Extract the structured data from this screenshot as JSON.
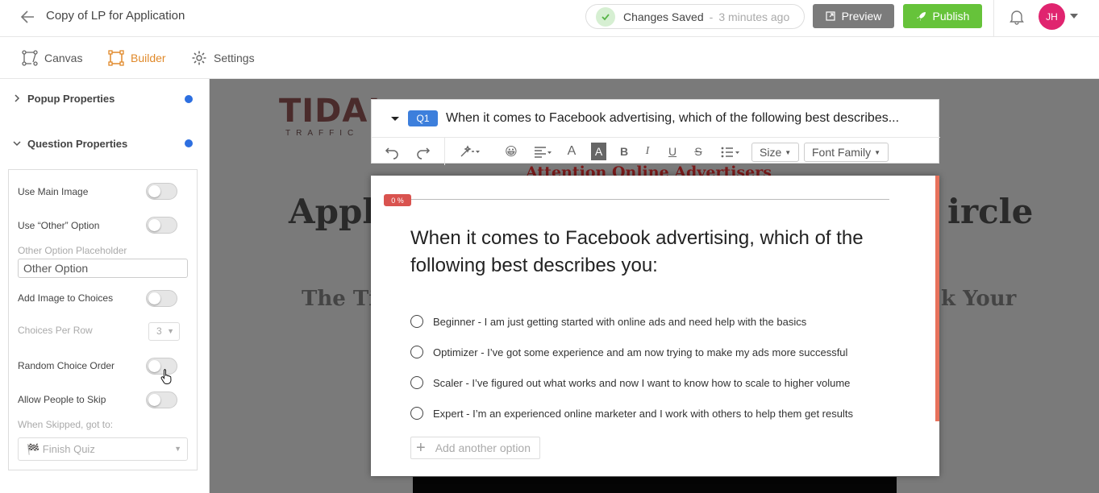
{
  "header": {
    "title": "Copy of LP for Application",
    "status_main": "Changes Saved",
    "status_sep": "-",
    "status_ago": "3 minutes ago",
    "preview_label": "Preview",
    "publish_label": "Publish",
    "avatar_initials": "JH"
  },
  "tabs": [
    {
      "label": "Canvas",
      "icon": "canvas-icon",
      "active": false
    },
    {
      "label": "Builder",
      "icon": "builder-icon",
      "active": true
    },
    {
      "label": "Settings",
      "icon": "gear-icon",
      "active": false
    }
  ],
  "sidebar": {
    "popup_properties": "Popup Properties",
    "question_properties": "Question Properties",
    "use_main_image": {
      "label": "Use Main Image",
      "on": false
    },
    "use_other_option": {
      "label": "Use “Other” Option",
      "on": false
    },
    "other_placeholder_label": "Other Option Placeholder",
    "other_placeholder_value": "Other Option",
    "add_image_to_choices": {
      "label": "Add Image to Choices",
      "on": false
    },
    "choices_per_row": {
      "label": "Choices Per Row",
      "value": "3"
    },
    "random_choice_order": {
      "label": "Random Choice Order",
      "on": false
    },
    "allow_skip": {
      "label": "Allow People to Skip",
      "on": false
    },
    "when_skipped_label": "When Skipped, got to:",
    "when_skipped_value": "🏁 Finish Quiz"
  },
  "editor": {
    "question_tag": "Q1",
    "question_title": "When it comes to Facebook advertising, which of the following best describes...",
    "size_label": "Size",
    "font_family_label": "Font Family"
  },
  "background": {
    "logo_text_a": "TIDAL",
    "logo_sub": "TRAFFIC",
    "attention": "Attention Online Advertisers",
    "headline_left": "Appl",
    "headline_right": "ircle",
    "subhead_left": "The Ti",
    "subhead_right": "k Your"
  },
  "popup": {
    "progress_label": "0 %",
    "progress": 0,
    "question": "When it comes to Facebook advertising, which of the following best describes you:",
    "options": [
      "Beginner - I am just getting started with online ads and need help with the basics",
      "Optimizer - I’ve got some experience and am now trying to make my ads more successful",
      "Scaler - I’ve figured out what works and now I want to know how to scale to higher volume",
      "Expert - I’m an experienced online marketer and I work with others to help them get results"
    ],
    "add_option": "Add another option"
  },
  "colors": {
    "accent_orange": "#e0892a",
    "publish_green": "#66c33a",
    "q1_blue": "#3d7fdc",
    "progress_red": "#d9534f"
  }
}
